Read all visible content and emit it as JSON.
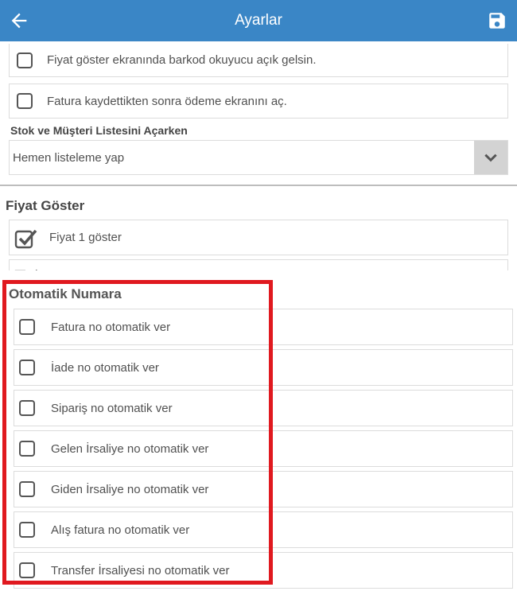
{
  "header": {
    "title": "Ayarlar",
    "back_icon": "arrow-left-icon",
    "save_icon": "floppy-disk-icon",
    "color": "#3a86c6"
  },
  "top_options": [
    {
      "label": "Fiyat göster ekranında barkod okuyucu açık gelsin.",
      "checked": false
    },
    {
      "label": "Fatura kaydettikten sonra ödeme ekranını aç.",
      "checked": false
    }
  ],
  "stock_list": {
    "title": "Stok ve Müşteri Listesini Açarken",
    "selected": "Hemen listeleme yap"
  },
  "price_section": {
    "title": "Fiyat Göster",
    "items": [
      {
        "label": "Fiyat 1 göster",
        "checked": true
      }
    ]
  },
  "auto_number": {
    "title": "Otomatik Numara",
    "highlight_color": "#e0191f",
    "items": [
      {
        "label": "Fatura no otomatik ver",
        "checked": false
      },
      {
        "label": "İade no otomatik ver",
        "checked": false
      },
      {
        "label": "Sipariş no otomatik ver",
        "checked": false
      },
      {
        "label": "Gelen İrsaliye no otomatik ver",
        "checked": false
      },
      {
        "label": "Giden İrsaliye no otomatik ver",
        "checked": false
      },
      {
        "label": "Alış fatura no otomatik ver",
        "checked": false
      },
      {
        "label": "Transfer İrsaliyesi no otomatik ver",
        "checked": false
      }
    ]
  }
}
